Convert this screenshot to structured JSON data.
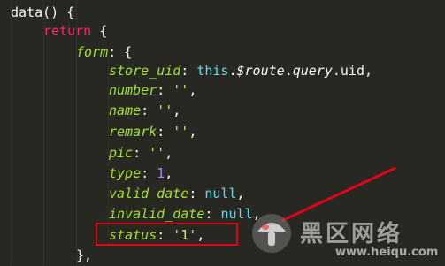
{
  "editor": {
    "lines": [
      {
        "indent": 0,
        "tokens": [
          {
            "t": "data",
            "c": "plain"
          },
          {
            "t": "() {",
            "c": "plain"
          }
        ]
      },
      {
        "indent": 1,
        "tokens": [
          {
            "t": "return",
            "c": "kwr"
          },
          {
            "t": " {",
            "c": "plain"
          }
        ]
      },
      {
        "indent": 2,
        "tokens": [
          {
            "t": "form",
            "c": "key"
          },
          {
            "t": ": {",
            "c": "plain"
          }
        ]
      },
      {
        "indent": 3,
        "tokens": [
          {
            "t": "store_uid",
            "c": "key"
          },
          {
            "t": ": ",
            "c": "plain"
          },
          {
            "t": "this",
            "c": "kw"
          },
          {
            "t": ".",
            "c": "plain"
          },
          {
            "t": "$route",
            "c": "var"
          },
          {
            "t": ".",
            "c": "plain"
          },
          {
            "t": "query",
            "c": "var"
          },
          {
            "t": ".uid,",
            "c": "plain"
          }
        ]
      },
      {
        "indent": 3,
        "tokens": [
          {
            "t": "number",
            "c": "key"
          },
          {
            "t": ": ",
            "c": "plain"
          },
          {
            "t": "''",
            "c": "str"
          },
          {
            "t": ",",
            "c": "plain"
          }
        ]
      },
      {
        "indent": 3,
        "tokens": [
          {
            "t": "name",
            "c": "key"
          },
          {
            "t": ": ",
            "c": "plain"
          },
          {
            "t": "''",
            "c": "str"
          },
          {
            "t": ",",
            "c": "plain"
          }
        ]
      },
      {
        "indent": 3,
        "tokens": [
          {
            "t": "remark",
            "c": "key"
          },
          {
            "t": ": ",
            "c": "plain"
          },
          {
            "t": "''",
            "c": "str"
          },
          {
            "t": ",",
            "c": "plain"
          }
        ]
      },
      {
        "indent": 3,
        "tokens": [
          {
            "t": "pic",
            "c": "key"
          },
          {
            "t": ": ",
            "c": "plain"
          },
          {
            "t": "''",
            "c": "str"
          },
          {
            "t": ",",
            "c": "plain"
          }
        ]
      },
      {
        "indent": 3,
        "tokens": [
          {
            "t": "type",
            "c": "key"
          },
          {
            "t": ": ",
            "c": "plain"
          },
          {
            "t": "1",
            "c": "num"
          },
          {
            "t": ",",
            "c": "plain"
          }
        ]
      },
      {
        "indent": 3,
        "tokens": [
          {
            "t": "valid_date",
            "c": "key"
          },
          {
            "t": ": ",
            "c": "plain"
          },
          {
            "t": "null",
            "c": "kw"
          },
          {
            "t": ",",
            "c": "plain"
          }
        ]
      },
      {
        "indent": 3,
        "tokens": [
          {
            "t": "invalid_date",
            "c": "key"
          },
          {
            "t": ": ",
            "c": "plain"
          },
          {
            "t": "null",
            "c": "kw"
          },
          {
            "t": ",",
            "c": "plain"
          }
        ]
      },
      {
        "indent": 3,
        "tokens": [
          {
            "t": "status",
            "c": "key"
          },
          {
            "t": ": ",
            "c": "plain"
          },
          {
            "t": "'1'",
            "c": "str"
          },
          {
            "t": ",",
            "c": "plain"
          }
        ]
      },
      {
        "indent": 2,
        "tokens": [
          {
            "t": "},",
            "c": "plain"
          }
        ]
      }
    ]
  },
  "watermark": {
    "text": "黑区网络",
    "url": "www.heiqu.com"
  },
  "colors": {
    "background": "#272822",
    "highlight_box": "#e3001b",
    "arrow": "#e3001b"
  }
}
